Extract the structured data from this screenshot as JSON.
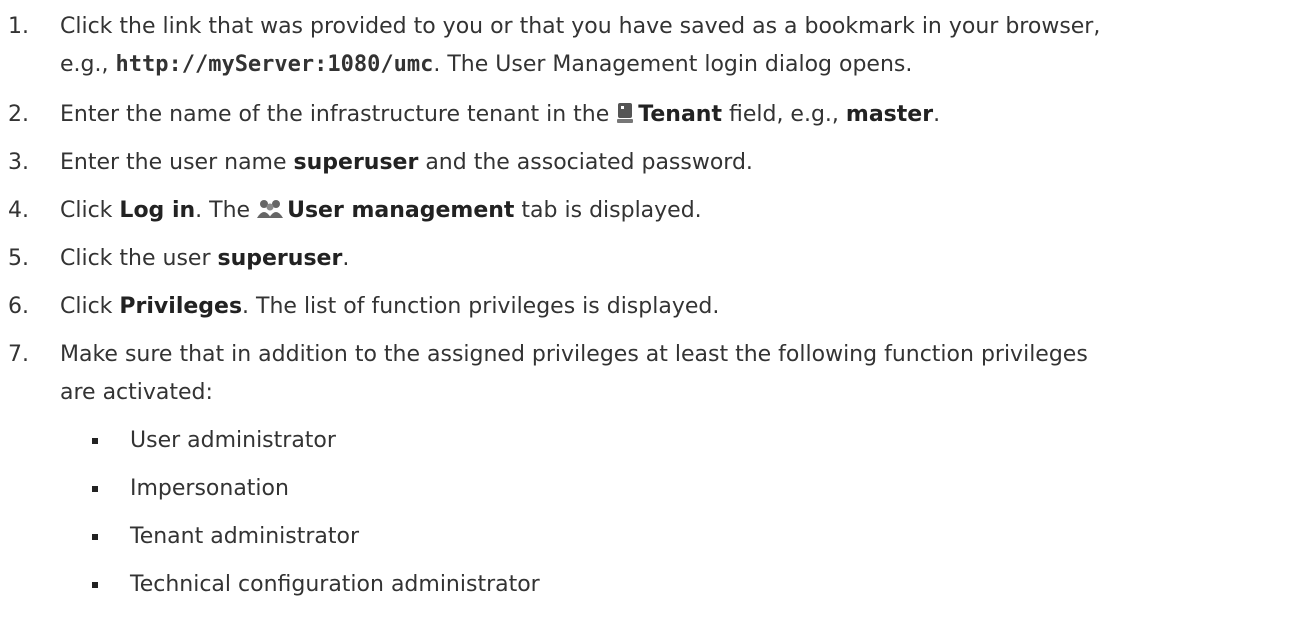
{
  "steps": [
    {
      "number": "1.",
      "t1": "Click the link that was provided to you or that you have saved as a bookmark in your browser,",
      "t2": "e.g., ",
      "url": "http://myServer:1080/umc",
      "t3": ". The User Management login dialog opens."
    },
    {
      "number": "2.",
      "t1": "Enter the name of the infrastructure tenant in the ",
      "icon": "tenant-database-icon",
      "field": "Tenant",
      "t2": " field, e.g., ",
      "example": "master",
      "t3": "."
    },
    {
      "number": "3.",
      "t1": "Enter the user name ",
      "user": "superuser",
      "t2": " and the associated password."
    },
    {
      "number": "4.",
      "t1": "Click ",
      "button": "Log in",
      "t2": ". The ",
      "icon": "users-group-icon",
      "tab": "User management",
      "t3": " tab is displayed."
    },
    {
      "number": "5.",
      "t1": "Click the user ",
      "user": "superuser",
      "t2": "."
    },
    {
      "number": "6.",
      "t1": "Click ",
      "button": "Privileges",
      "t2": ". The list of function privileges is displayed."
    },
    {
      "number": "7.",
      "t1": "Make sure that in addition to the assigned privileges at least the following function privileges",
      "t2": "are activated:",
      "privileges": [
        "User administrator",
        "Impersonation",
        "Tenant administrator",
        "Technical configuration administrator"
      ]
    }
  ]
}
